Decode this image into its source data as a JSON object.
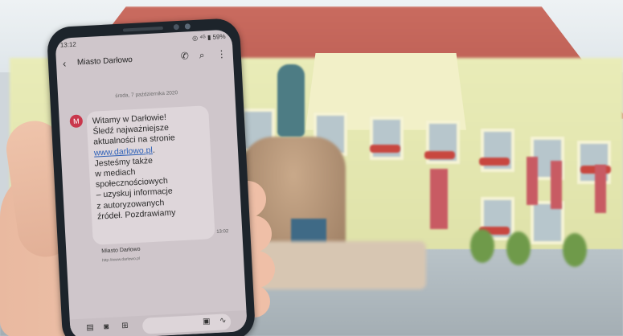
{
  "phone": {
    "status_time": "13:12",
    "status_right": "◎ ⁴ᴳ ▮ 59%",
    "contact_name": "Miasto Darłowo",
    "date": "środa, 7 października 2020",
    "avatar_letter": "M",
    "message": {
      "line1": "Witamy w Darłowie!",
      "line2": "Śledź najważniejsze",
      "line3": "aktualności na stronie",
      "link": "www.darlowo.pl",
      "after_link": ".",
      "line5": "Jesteśmy także",
      "line6": "w mediach",
      "line7": "społecznościowych",
      "line8": "– uzyskuj informacje",
      "line9": "z autoryzowanych",
      "line10": "źródeł. Pozdrawiamy"
    },
    "message_time": "13:02",
    "preview_title": "Miasto Darłowo",
    "preview_url": "http://www.darlowo.pl"
  },
  "colors": {
    "avatar": "#c9374c",
    "link": "#2c5fb7",
    "roof": "#c96b5f",
    "facade": "#e9ecb8"
  },
  "icons": [
    "back-arrow-icon",
    "phone-icon",
    "search-icon",
    "more-icon",
    "attach-icon",
    "camera-icon",
    "apps-icon",
    "sticker-icon",
    "voice-icon"
  ]
}
